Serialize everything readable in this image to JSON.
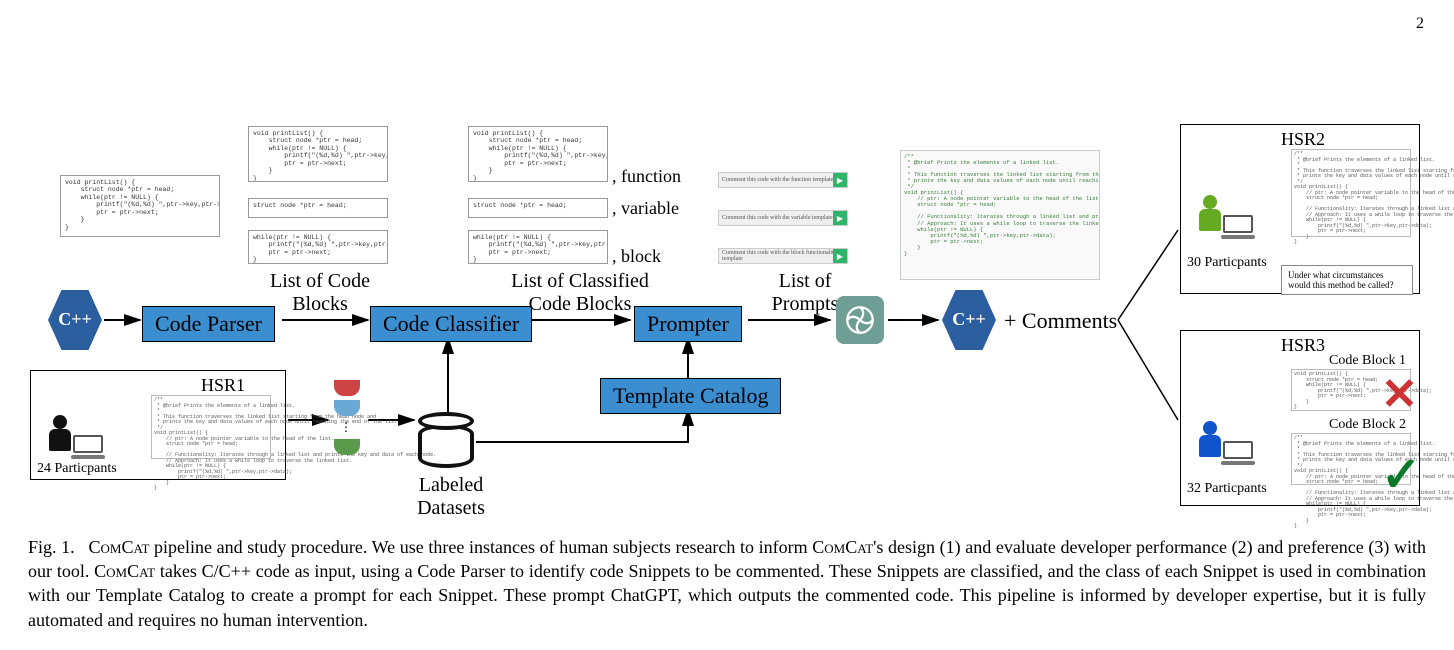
{
  "page_number": "2",
  "pipeline": {
    "code_parser": "Code Parser",
    "code_classifier": "Code Classifier",
    "prompter": "Prompter",
    "template_catalog": "Template Catalog",
    "labels": {
      "list_code_blocks": "List of Code\nBlocks",
      "list_classified": "List of Classified\nCode Blocks",
      "list_prompts": "List of\nPrompts",
      "labeled_datasets": "Labeled\nDatasets",
      "plus_comments": "+ Comments"
    },
    "tags": {
      "function": ", function",
      "variable": ", variable",
      "block": ", block"
    },
    "code_samples": {
      "printlist_full": "void printList() {\n    struct node *ptr = head;\n    while(ptr != NULL) {\n        printf(\"(%d,%d) \",ptr->key,ptr->data);\n        ptr = ptr->next;\n    }\n}",
      "struct_line": "struct node *ptr = head;",
      "while_block": "while(ptr != NULL) {\n    printf(\"(%d,%d) \",ptr->key,ptr->data);\n    ptr = ptr->next;\n}"
    },
    "prompts": {
      "p_func": "Comment this code with the function template",
      "p_var": "Comment this code with the variable template",
      "p_block": "Comment this code with the block functionality template"
    },
    "commented_output": "/**\n * @brief Prints the elements of a linked list.\n *\n * This function traverses the linked list starting from the head node and\n * prints the key and data values of each node until reaching the end of the list.\n */\nvoid printList() {\n    // ptr: A node pointer variable to the head of the list.\n    struct node *ptr = head;\n\n    // Functionality: Iterates through a linked list and prints the key and data of each node.\n    // Approach: It uses a while loop to traverse the linked list.\n    while(ptr != NULL) {\n        printf(\"(%d,%d) \",ptr->key,ptr->data);\n        ptr = ptr->next;\n    }\n}"
  },
  "hsr": {
    "hsr1": {
      "title": "HSR1",
      "participants": "24 Particpants"
    },
    "hsr2": {
      "title": "HSR2",
      "participants": "30 Particpants",
      "question": "Under what circumstances would this method be called?"
    },
    "hsr3": {
      "title": "HSR3",
      "participants": "32 Particpants",
      "block1": "Code Block 1",
      "block2": "Code Block 2"
    }
  },
  "caption": {
    "fig_label": "Fig. 1.",
    "text_1": " pipeline and study procedure. We use three instances of human subjects research to inform ",
    "text_2": "'s design (1) and evaluate developer performance (2) and preference (3) with our tool. ",
    "text_3": " takes C/C++ code as input, using a Code Parser to identify code Snippets to be commented. These Snippets are classified, and the class of each Snippet is used in combination with our Template Catalog to create a prompt for each Snippet. These prompt ChatGPT, which outputs the commented code. This pipeline is informed by developer expertise, but it is fully automated and requires no human intervention.",
    "comcat": "ComCat"
  },
  "icons": {
    "cpp": "C++",
    "openai": "openai-knot-icon"
  }
}
